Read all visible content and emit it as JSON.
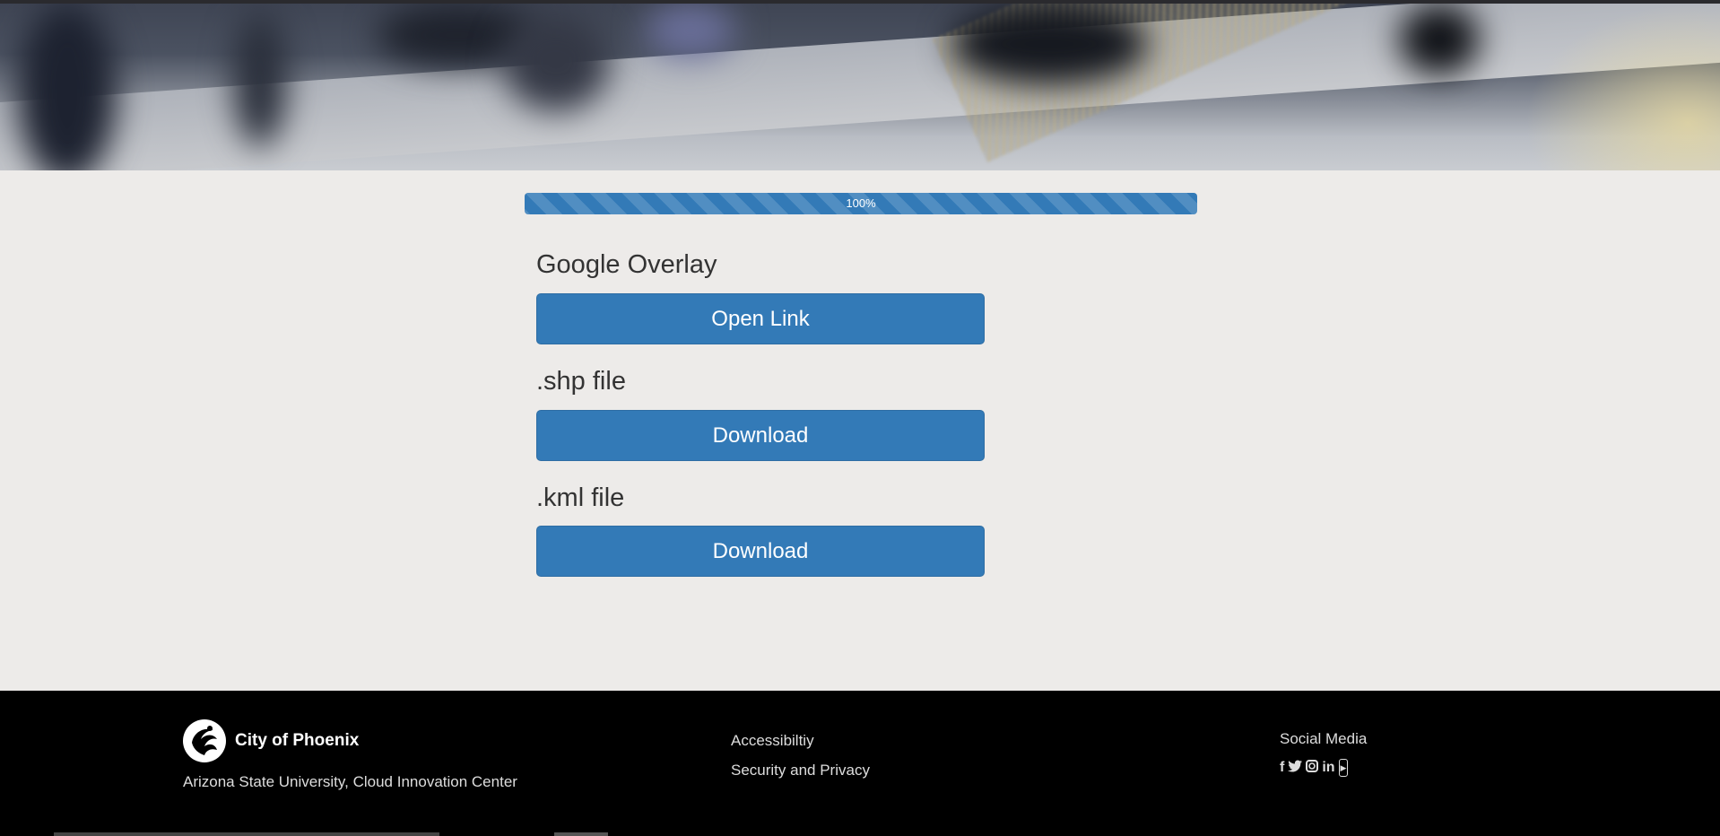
{
  "progress": {
    "label": "100%",
    "value": 1.0
  },
  "sections": [
    {
      "title": "Google Overlay",
      "button_label": "Open Link"
    },
    {
      "title": ".shp file",
      "button_label": "Download"
    },
    {
      "title": ".kml file",
      "button_label": "Download"
    }
  ],
  "footer": {
    "brand_name": "City of Phoenix",
    "brand_sub": "Arizona State University, Cloud Innovation Center",
    "links": [
      "Accessibiltiy",
      "Security and Privacy"
    ],
    "social_title": "Social Media",
    "social_icons": [
      "facebook-icon",
      "twitter-icon",
      "instagram-icon",
      "linkedin-icon",
      "youtube-icon"
    ]
  },
  "colors": {
    "primary": "#337ab7",
    "page_bg": "#edebe9",
    "footer_bg": "#000000"
  }
}
